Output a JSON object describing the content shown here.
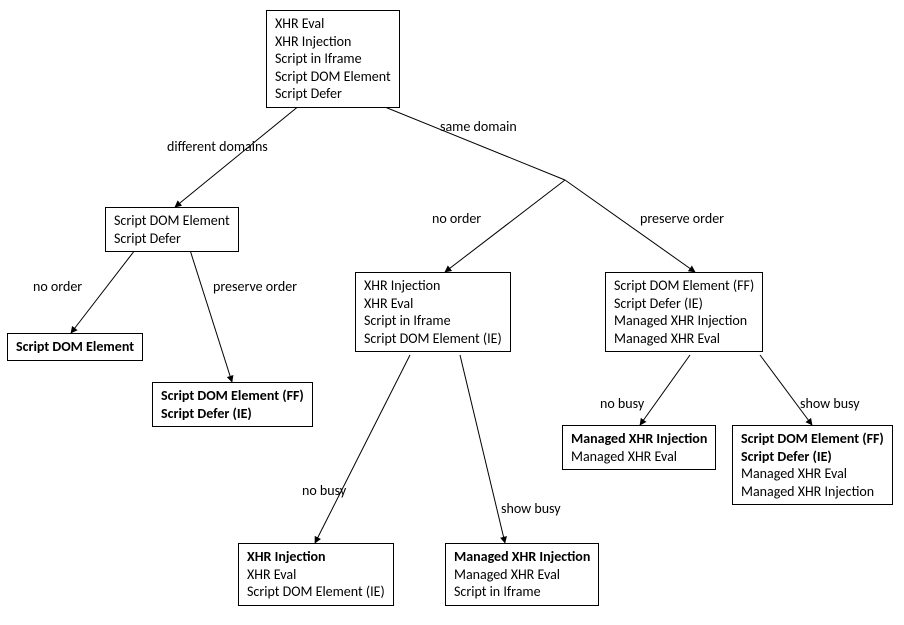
{
  "nodes": {
    "root": {
      "lines": [
        {
          "text": "XHR Eval",
          "bold": false
        },
        {
          "text": "XHR Injection",
          "bold": false
        },
        {
          "text": "Script in Iframe",
          "bold": false
        },
        {
          "text": "Script DOM Element",
          "bold": false
        },
        {
          "text": "Script Defer",
          "bold": false
        }
      ]
    },
    "diff_domain": {
      "lines": [
        {
          "text": "Script DOM Element",
          "bold": false
        },
        {
          "text": "Script Defer",
          "bold": false
        }
      ]
    },
    "dd_no_order": {
      "lines": [
        {
          "text": "Script DOM Element",
          "bold": true
        }
      ]
    },
    "dd_preserve": {
      "lines": [
        {
          "text": "Script DOM Element (FF)",
          "bold": true
        },
        {
          "text": "Script Defer (IE)",
          "bold": true
        }
      ]
    },
    "sd_no_order": {
      "lines": [
        {
          "text": "XHR Injection",
          "bold": false
        },
        {
          "text": "XHR Eval",
          "bold": false
        },
        {
          "text": "Script in Iframe",
          "bold": false
        },
        {
          "text": "Script DOM Element (IE)",
          "bold": false
        }
      ]
    },
    "sd_preserve": {
      "lines": [
        {
          "text": "Script DOM Element (FF)",
          "bold": false
        },
        {
          "text": "Script Defer (IE)",
          "bold": false
        },
        {
          "text": "Managed XHR Injection",
          "bold": false
        },
        {
          "text": "Managed XHR Eval",
          "bold": false
        }
      ]
    },
    "sdp_no_busy": {
      "lines": [
        {
          "text": "Managed XHR Injection",
          "bold": true
        },
        {
          "text": "Managed XHR Eval",
          "bold": false
        }
      ]
    },
    "sdp_show_busy": {
      "lines": [
        {
          "text": "Script DOM Element (FF)",
          "bold": true
        },
        {
          "text": "Script Defer (IE)",
          "bold": true
        },
        {
          "text": "Managed XHR Eval",
          "bold": false
        },
        {
          "text": "Managed XHR Injection",
          "bold": false
        }
      ]
    },
    "sdn_no_busy": {
      "lines": [
        {
          "text": "XHR Injection",
          "bold": true
        },
        {
          "text": "XHR Eval",
          "bold": false
        },
        {
          "text": "Script DOM Element (IE)",
          "bold": false
        }
      ]
    },
    "sdn_show_busy": {
      "lines": [
        {
          "text": "Managed XHR Injection",
          "bold": true
        },
        {
          "text": "Managed XHR Eval",
          "bold": false
        },
        {
          "text": "Script in Iframe",
          "bold": false
        }
      ]
    }
  },
  "edges": {
    "root_left": "different domains",
    "root_right": "same domain",
    "dd_left": "no order",
    "dd_right": "preserve order",
    "sd_left": "no order",
    "sd_right": "preserve order",
    "sdp_left": "no busy",
    "sdp_right": "show busy",
    "sdn_left": "no busy",
    "sdn_right": "show busy"
  }
}
